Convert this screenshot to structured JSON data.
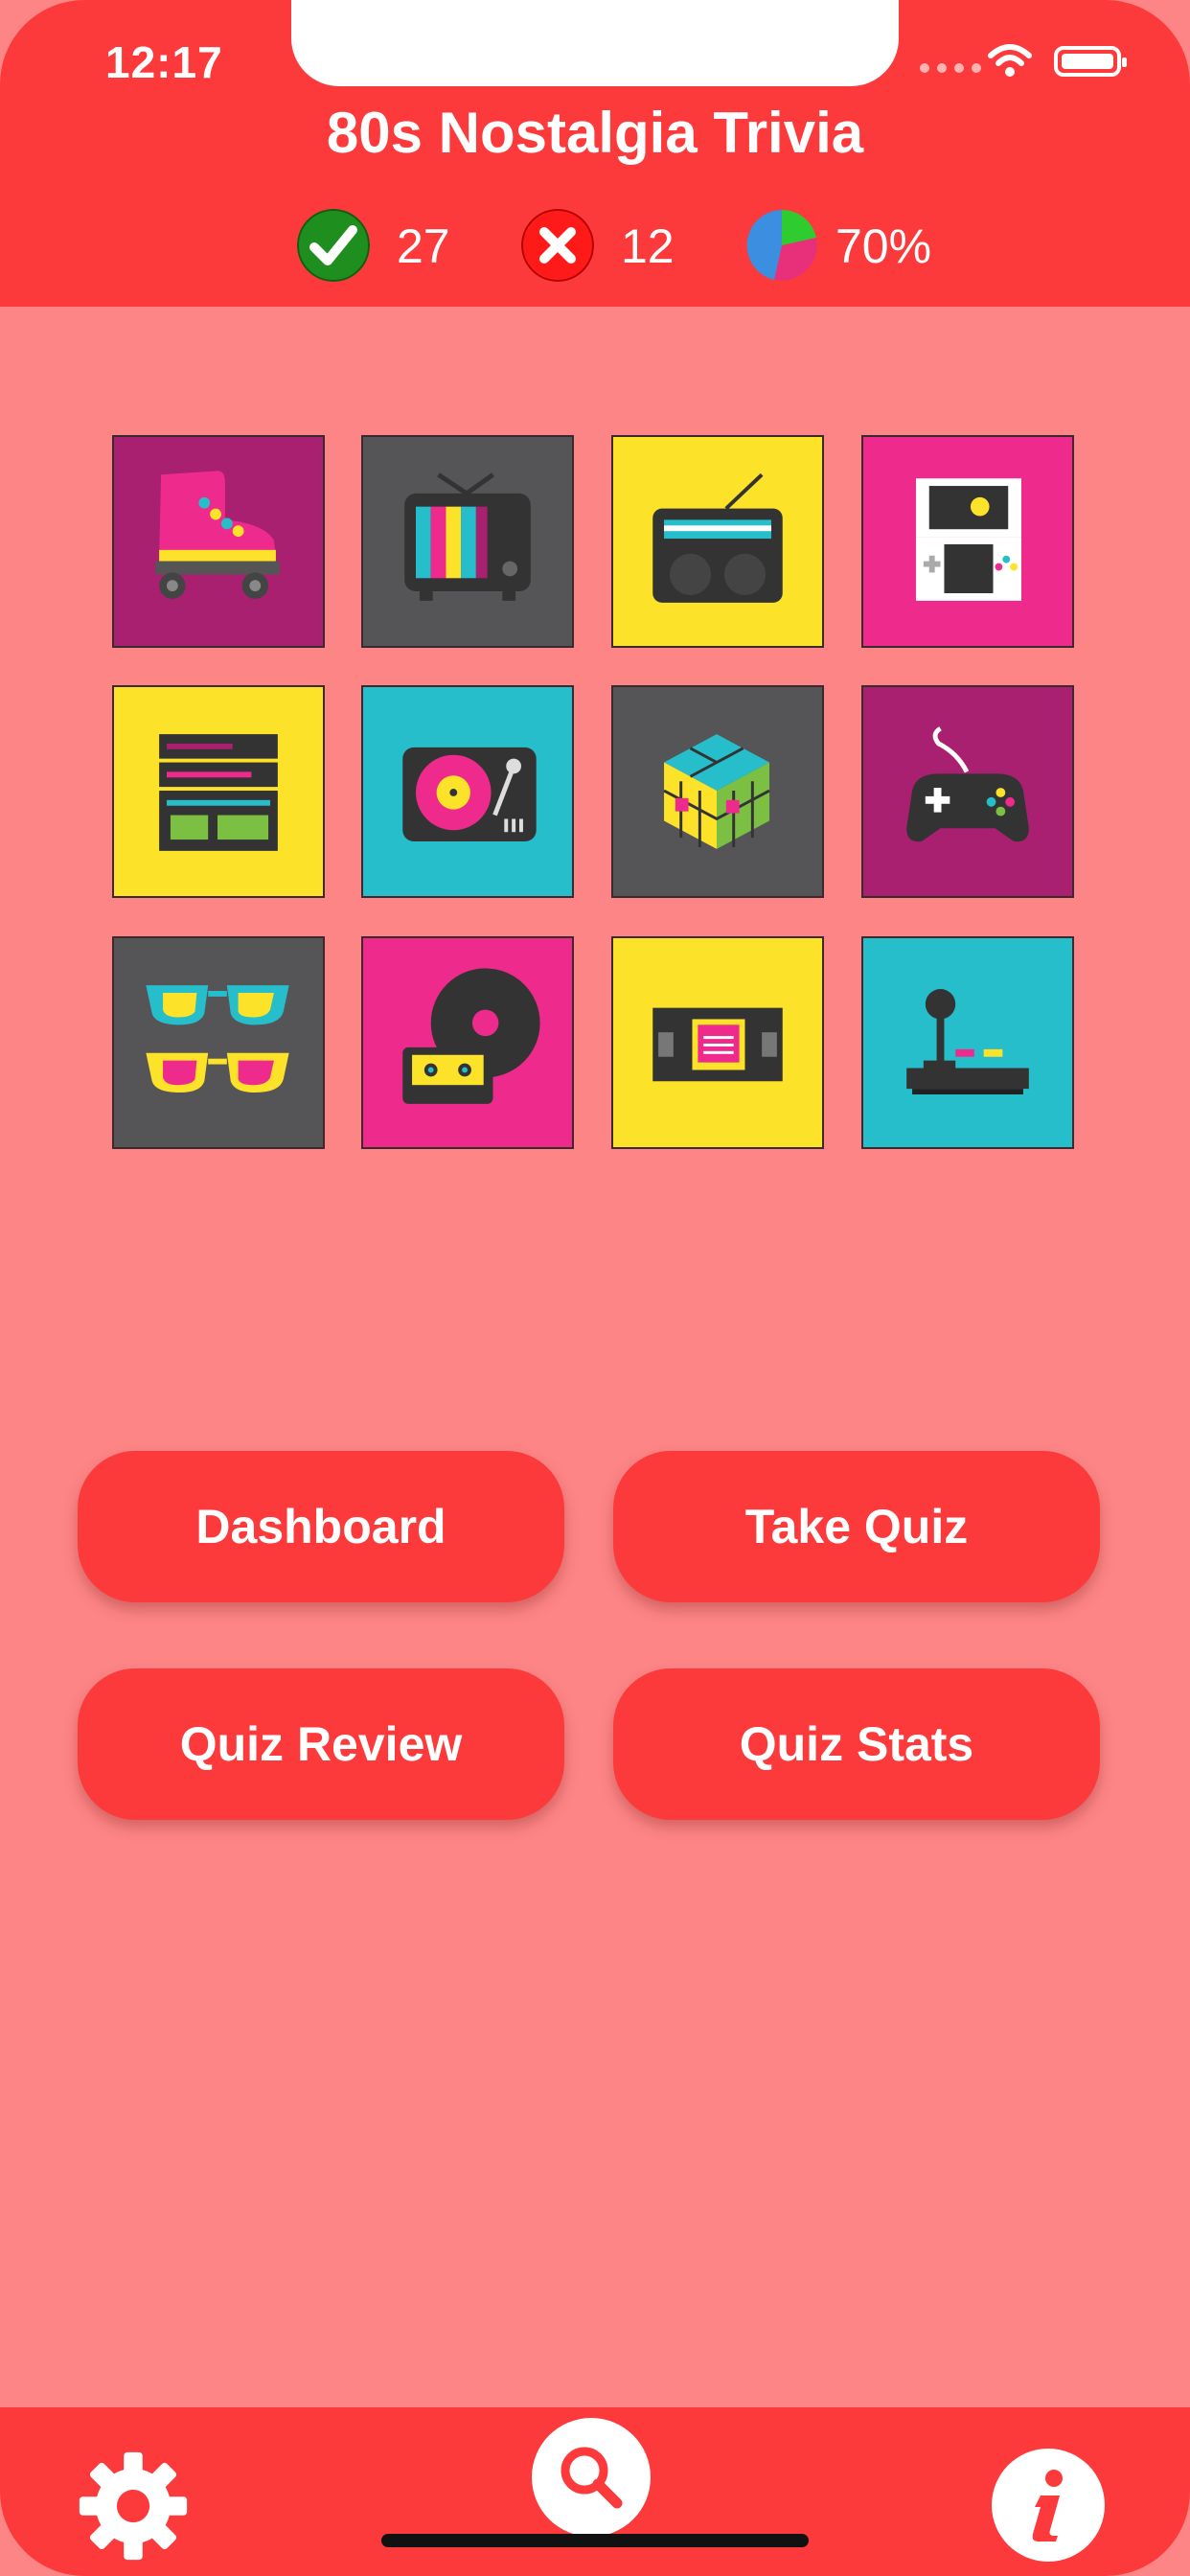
{
  "status_bar": {
    "time": "12:17"
  },
  "header": {
    "title": "80s Nostalgia Trivia",
    "correct_count": "27",
    "incorrect_count": "12",
    "percent": "70%"
  },
  "tiles": [
    {
      "name": "roller-skate-icon",
      "bg": "#a92070"
    },
    {
      "name": "retro-tv-icon",
      "bg": "#555558"
    },
    {
      "name": "boombox-radio-icon",
      "bg": "#fde22a"
    },
    {
      "name": "handheld-game-icon",
      "bg": "#ee2b8c"
    },
    {
      "name": "stereo-equalizer-icon",
      "bg": "#fde22a"
    },
    {
      "name": "turntable-icon",
      "bg": "#27becc"
    },
    {
      "name": "rubiks-cube-icon",
      "bg": "#555558"
    },
    {
      "name": "gamepad-icon",
      "bg": "#a92070"
    },
    {
      "name": "sunglasses-icon",
      "bg": "#555558"
    },
    {
      "name": "vinyl-cassette-icon",
      "bg": "#ee2b8c"
    },
    {
      "name": "vhs-tape-icon",
      "bg": "#fde22a"
    },
    {
      "name": "arcade-joystick-icon",
      "bg": "#27becc"
    }
  ],
  "buttons": {
    "dashboard": "Dashboard",
    "take_quiz": "Take Quiz",
    "quiz_review": "Quiz Review",
    "quiz_stats": "Quiz Stats"
  },
  "bottom_bar": {
    "left_icon": "gear-icon",
    "center_icon": "search-icon",
    "right_icon": "info-icon"
  },
  "colors": {
    "accent": "#fd3a3b",
    "background": "#fd8585",
    "correct": "#1e8f1e",
    "incorrect": "#ff1a1a"
  }
}
